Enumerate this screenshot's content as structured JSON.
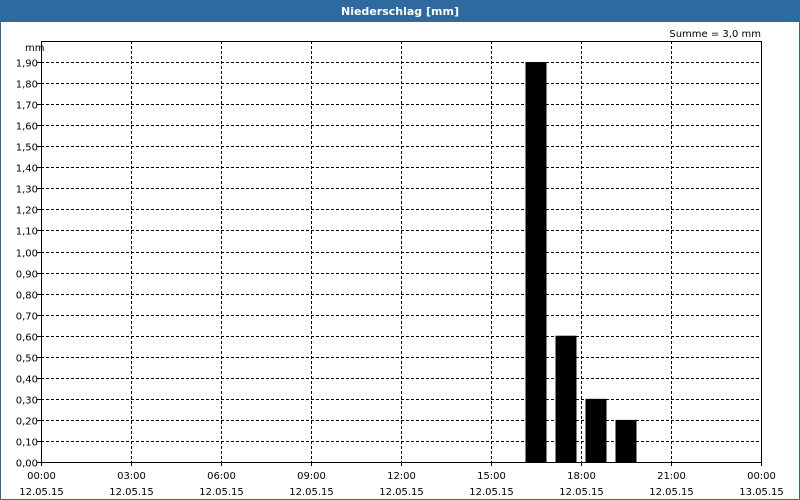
{
  "window": {
    "title": "Niederschlag [mm]"
  },
  "chart_data": {
    "type": "bar",
    "title": "Niederschlag [mm]",
    "ylabel": "mm",
    "annotation": "Summe = 3,0 mm",
    "ylim": [
      0,
      2.0
    ],
    "y_ticks": [
      {
        "value": 0.0,
        "label": "0,00"
      },
      {
        "value": 0.1,
        "label": "0,10"
      },
      {
        "value": 0.2,
        "label": "0,20"
      },
      {
        "value": 0.3,
        "label": "0,30"
      },
      {
        "value": 0.4,
        "label": "0,40"
      },
      {
        "value": 0.5,
        "label": "0,50"
      },
      {
        "value": 0.6,
        "label": "0,60"
      },
      {
        "value": 0.7,
        "label": "0,70"
      },
      {
        "value": 0.8,
        "label": "0,80"
      },
      {
        "value": 0.9,
        "label": "0,90"
      },
      {
        "value": 1.0,
        "label": "1,00"
      },
      {
        "value": 1.1,
        "label": "1,10"
      },
      {
        "value": 1.2,
        "label": "1,20"
      },
      {
        "value": 1.3,
        "label": "1,30"
      },
      {
        "value": 1.4,
        "label": "1,40"
      },
      {
        "value": 1.5,
        "label": "1,50"
      },
      {
        "value": 1.6,
        "label": "1,60"
      },
      {
        "value": 1.7,
        "label": "1,70"
      },
      {
        "value": 1.8,
        "label": "1,80"
      },
      {
        "value": 1.9,
        "label": "1,90"
      }
    ],
    "x_range_hours": [
      0,
      24
    ],
    "x_ticks": [
      {
        "hour": 0,
        "time": "00:00",
        "date": "12.05.15"
      },
      {
        "hour": 3,
        "time": "03:00",
        "date": "12.05.15"
      },
      {
        "hour": 6,
        "time": "06:00",
        "date": "12.05.15"
      },
      {
        "hour": 9,
        "time": "09:00",
        "date": "12.05.15"
      },
      {
        "hour": 12,
        "time": "12:00",
        "date": "12.05.15"
      },
      {
        "hour": 15,
        "time": "15:00",
        "date": "12.05.15"
      },
      {
        "hour": 18,
        "time": "18:00",
        "date": "12.05.15"
      },
      {
        "hour": 21,
        "time": "21:00",
        "date": "12.05.15"
      },
      {
        "hour": 24,
        "time": "00:00",
        "date": "13.05.15"
      }
    ],
    "bars": [
      {
        "start_hour": 16,
        "end_hour": 17,
        "value": 1.9
      },
      {
        "start_hour": 17,
        "end_hour": 18,
        "value": 0.6
      },
      {
        "start_hour": 18,
        "end_hour": 19,
        "value": 0.3
      },
      {
        "start_hour": 19,
        "end_hour": 20,
        "value": 0.2
      }
    ],
    "grid": true,
    "bar_color": "#000000",
    "title_bar_color": "#2e6aa0"
  }
}
